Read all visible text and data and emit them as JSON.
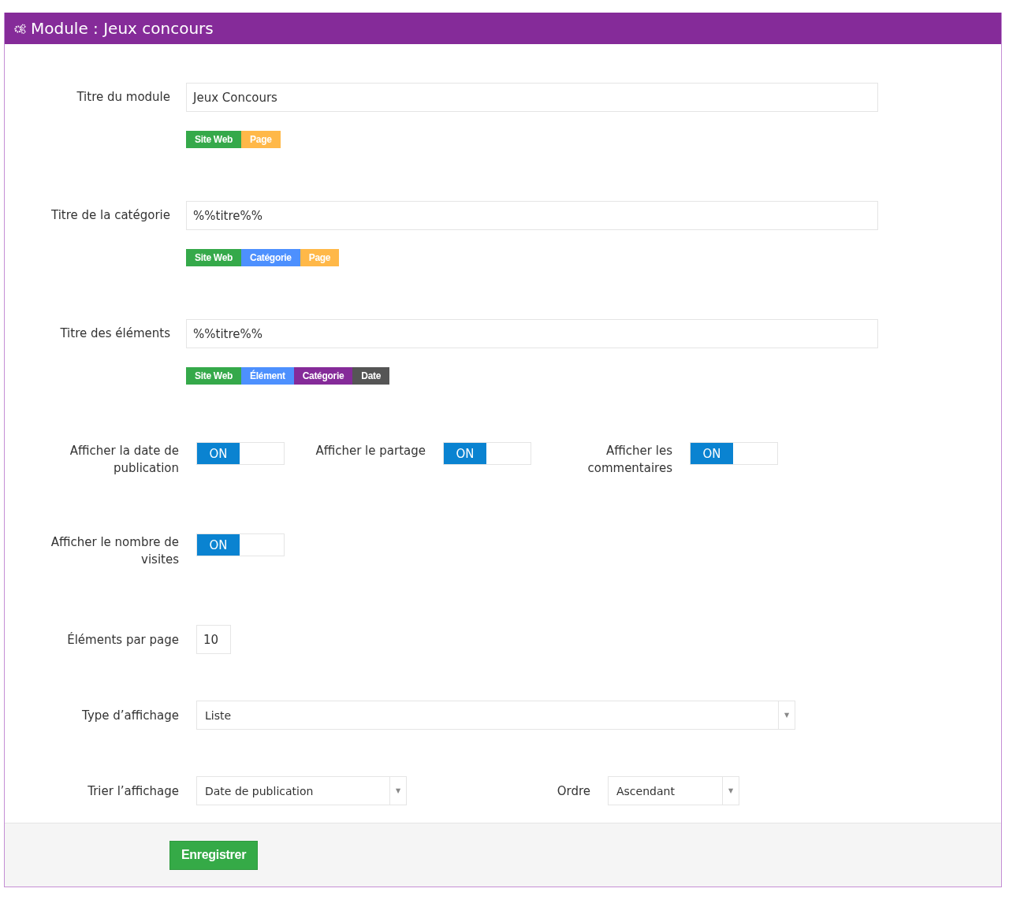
{
  "header": {
    "title": "Module : Jeux concours"
  },
  "title_fields": [
    {
      "label": "Titre du module",
      "value": "Jeux Concours",
      "tags": [
        {
          "label": "Site Web",
          "color": "#35a94a"
        },
        {
          "label": "Page",
          "color": "#ffb848"
        }
      ]
    },
    {
      "label": "Titre de la catégorie",
      "value": "%%titre%%",
      "tags": [
        {
          "label": "Site Web",
          "color": "#35a94a"
        },
        {
          "label": "Catégorie",
          "color": "#4d90fe"
        },
        {
          "label": "Page",
          "color": "#ffb848"
        }
      ]
    },
    {
      "label": "Titre des éléments",
      "value": "%%titre%%",
      "tags": [
        {
          "label": "Site Web",
          "color": "#35a94a"
        },
        {
          "label": "Élément",
          "color": "#4d90fe"
        },
        {
          "label": "Catégorie",
          "color": "#852b99"
        },
        {
          "label": "Date",
          "color": "#555555"
        }
      ]
    }
  ],
  "toggle_rows": [
    [
      {
        "label": "Afficher la date de publication",
        "on": true,
        "text": "ON"
      },
      {
        "label": "Afficher le partage",
        "on": true,
        "text": "ON"
      },
      {
        "label": "Afficher les commentaires",
        "on": true,
        "text": "ON"
      }
    ],
    [
      {
        "label": "Afficher le nombre de visites",
        "on": true,
        "text": "ON"
      }
    ]
  ],
  "per_page": {
    "label": "Éléments par page",
    "value": "10"
  },
  "display_type": {
    "label": "Type d’affichage",
    "value": "Liste",
    "arrow": "▼"
  },
  "sort": {
    "label": "Trier l’affichage",
    "value": "Date de publication",
    "arrow": "▼"
  },
  "order": {
    "label": "Ordre",
    "value": "Ascendant",
    "arrow": "▼"
  },
  "save_button": "Enregistrer"
}
